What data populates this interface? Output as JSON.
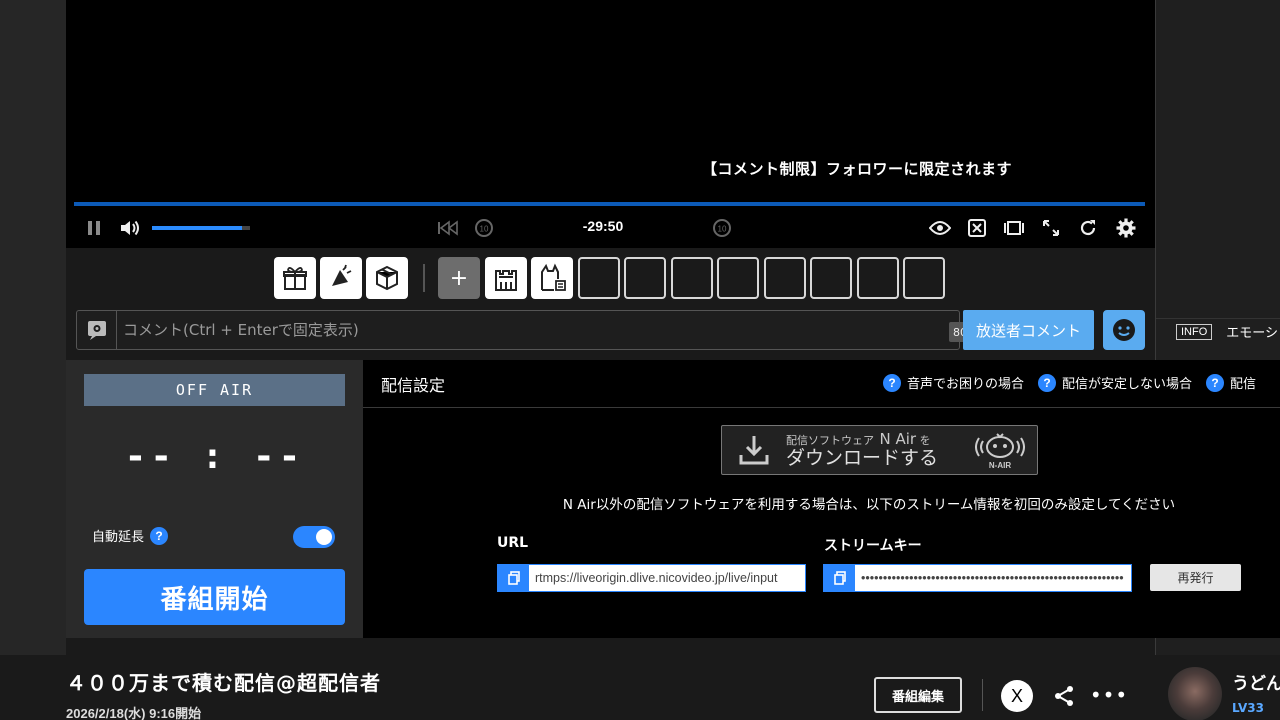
{
  "player": {
    "notice": "【コメント制限】フォロワーに限定されます",
    "timecode": "-29:50",
    "volume_level": 0.92
  },
  "giftbar": {
    "buttons": [
      "gift-icon",
      "advertise-icon",
      "box-icon",
      "plus-icon",
      "castle-icon",
      "cat-icon"
    ],
    "empty_slots": 8
  },
  "comment": {
    "placeholder": "コメント(Ctrl + Enterで固定表示)",
    "char_count": "80",
    "broadcaster_button": "放送者コメント"
  },
  "side": {
    "info_badge": "INFO",
    "info_text": "エモーシ"
  },
  "status": {
    "onair_label": "OFF AIR",
    "timer": "-- : --",
    "auto_extend_label": "自動延長",
    "auto_extend_enabled": true,
    "start_button": "番組開始"
  },
  "settings": {
    "title": "配信設定",
    "help_links": [
      "音声でお困りの場合",
      "配信が安定しない場合",
      "配信"
    ],
    "download_sub": "配信ソフトウェア",
    "download_product": "N Air",
    "download_suffix": "を",
    "download_main": "ダウンロードする",
    "logo_text": "N-AIR",
    "info": "N Air以外の配信ソフトウェアを利用する場合は、以下のストリーム情報を初回のみ設定してください",
    "url_label": "URL",
    "url_value": "rtmps://liveorigin.dlive.nicovideo.jp/live/input",
    "key_label": "ストリームキー",
    "key_value": "••••••••••••••••••••••••••••••••••••••••••••••••••••••••••••",
    "reissue_button": "再発行"
  },
  "program": {
    "title": "４００万まで積む配信@超配信者",
    "start": "2026/2/18(水) 9:16開始",
    "edit_button": "番組編集",
    "x_button": "X"
  },
  "user": {
    "name": "うどん",
    "level_prefix": "LV",
    "level": "33"
  },
  "colors": {
    "accent": "#2b86ff",
    "broadcaster_btn": "#5aabf0",
    "offair": "#5b7087",
    "seekbar": "#0c5ab7"
  }
}
